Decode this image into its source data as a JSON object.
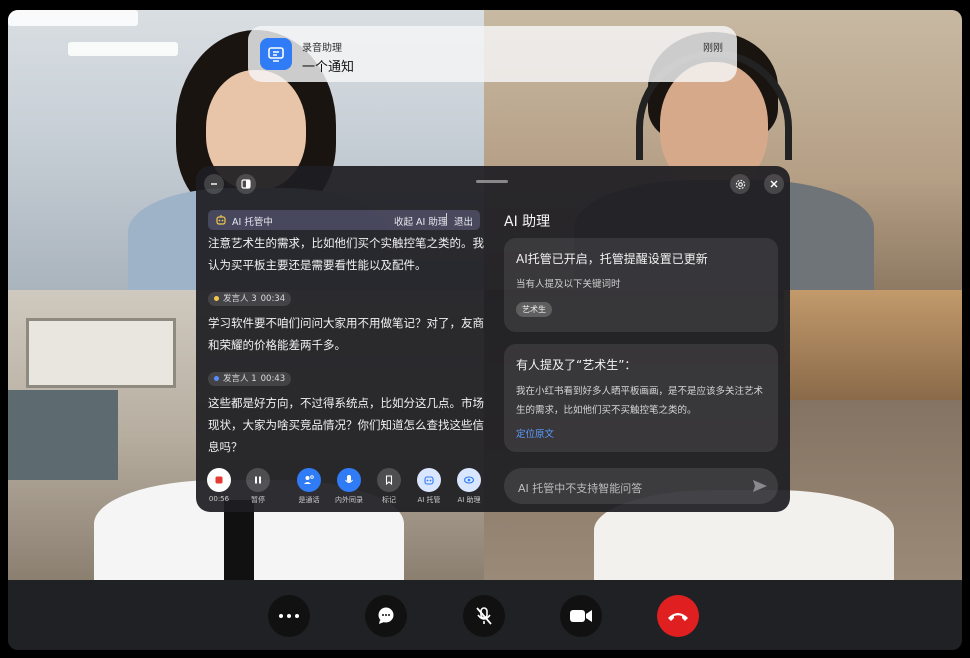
{
  "notification": {
    "app_name": "录音助理",
    "message": "一个通知",
    "time": "刚刚"
  },
  "panel": {
    "left": {
      "ai_host_label": "AI 托管中",
      "collapse_label": "收起 AI 助理",
      "exit_label": "退出",
      "transcript": [
        {
          "text": "注意艺术生的需求，比如他们买个实触控笔之类的。我认为买平板主要还是需要看性能以及配件。"
        },
        {
          "speaker": "发言人 3",
          "time": "00:34",
          "speaker_color": "#f2c94c",
          "text": "学习软件要不咱们问问大家用不用做笔记？对了，友商和荣耀的价格能差两千多。"
        },
        {
          "speaker": "发言人 1",
          "time": "00:43",
          "speaker_color": "#5b8cff",
          "text": "这些都是好方向，不过得系统点，比如分这几点。市场现状，大家为啥买竞品情况？你们知道怎么查找这些信息吗？"
        }
      ],
      "controls": [
        {
          "label": "00:56",
          "icon": "record-stop-icon"
        },
        {
          "label": "暂停",
          "icon": "pause-icon"
        },
        {
          "label": "是通话",
          "icon": "speaker-toggle-icon"
        },
        {
          "label": "内外同录",
          "icon": "microphone-icon"
        },
        {
          "label": "标记",
          "icon": "bookmark-icon"
        },
        {
          "label": "AI 托管",
          "icon": "ai-host-icon"
        },
        {
          "label": "AI 助理",
          "icon": "ai-assistant-icon"
        }
      ]
    },
    "right": {
      "title": "AI 助理",
      "card1": {
        "title": "AI托管已开启，托管提醒设置已更新",
        "subtitle": "当有人提及以下关键词时",
        "tag": "艺术生"
      },
      "card2": {
        "title": "有人提及了“艺术生”：",
        "body": "我在小红书看到好多人晒平板画画，是不是应该多关注艺术生的需求，比如他们买不买触控笔之类的。",
        "link": "定位原文"
      },
      "input_placeholder": "AI 托管中不支持智能问答"
    }
  },
  "colors": {
    "accent_blue": "#2f7cf6",
    "end_call_red": "#e02020",
    "record_red": "#e53935",
    "link_blue": "#5b9cff"
  },
  "toolbar_icons": [
    "more-icon",
    "chat-icon",
    "mic-muted-icon",
    "video-icon",
    "end-call-icon"
  ]
}
